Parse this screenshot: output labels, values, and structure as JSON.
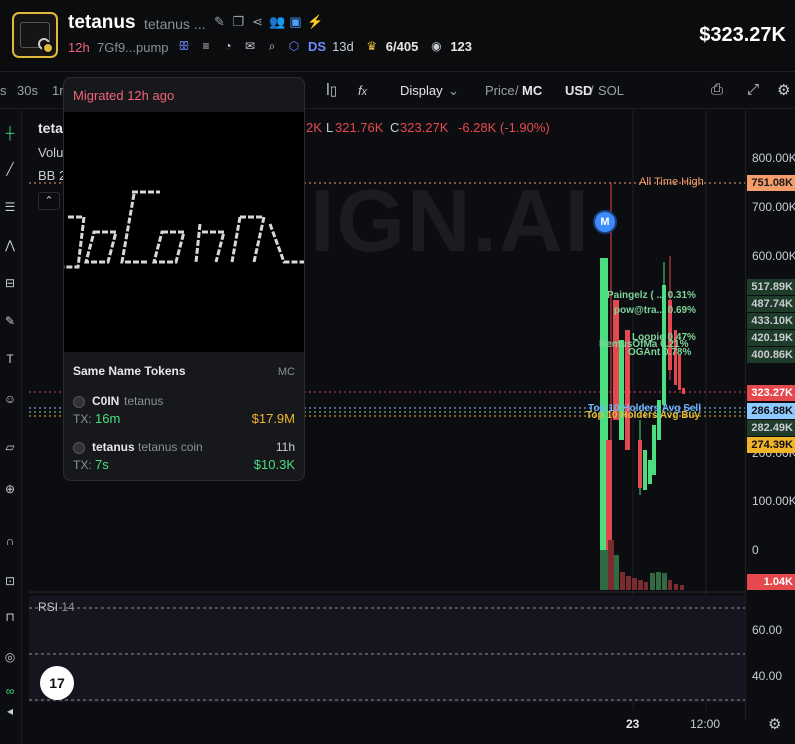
{
  "header": {
    "token_name": "tetanus",
    "token_subname": "tetanus ...",
    "age": "12h",
    "address": "7Gf9...pump",
    "ds_label": "DS",
    "ds_value": "13d",
    "holders": "6/405",
    "viewers": "123",
    "price": "$323.27K",
    "icons": [
      "edit-icon",
      "copy-icon",
      "share-icon",
      "users-icon",
      "twitter-icon",
      "bolt-icon"
    ]
  },
  "toolbar": {
    "tf_s": "s",
    "tf_30s": "30s",
    "tf_1m": "1r",
    "display": "Display",
    "price_label": "Price",
    "mc_label": "MC",
    "usd_label": "USD",
    "sol_label": "SOL"
  },
  "chart": {
    "symbol": "teta",
    "volume_label": "Volu",
    "bb_label": "BB 2",
    "ohlc": {
      "h_value": "2K",
      "l_label": "L",
      "l_value": "321.76K",
      "c_label": "C",
      "c_value": "323.27K",
      "change": "-6.28K (-1.90%)"
    },
    "watermark": "IGN.AI",
    "migration_marker": "M",
    "all_time_high_label": "All Time High",
    "annotations": [
      {
        "label": "Paingelz  ( ... 0.31%",
        "color": "#7fd39a"
      },
      {
        "label": "pow@tra... 0.69%",
        "color": "#7fd39a"
      },
      {
        "label": "Loopie  0.47%",
        "color": "#7fd39a"
      },
      {
        "label": "RemusOfMa  0.21%",
        "color": "#7fd39a"
      },
      {
        "label": "OGAnt  0.78%",
        "color": "#7fd39a"
      },
      {
        "label": "Top 10 Holders Avg Sell",
        "color": "#6fb6ff"
      },
      {
        "label": "Top 10 Holders Avg Buy",
        "color": "#e2b93b"
      }
    ],
    "rsi_label": "RSI",
    "rsi_value": "14",
    "tv_logo": "17"
  },
  "yaxis": {
    "ticks": [
      "800.00K",
      "700.00K",
      "600.00K",
      "200.00K",
      "100.00K",
      "0",
      "60.00",
      "40.00"
    ],
    "badges": [
      {
        "value": "751.08K",
        "bg": "#f59e6b",
        "fg": "#1a1a1a"
      },
      {
        "value": "517.89K",
        "bg": "#1f3b2a",
        "fg": "#c9ccd2"
      },
      {
        "value": "487.74K",
        "bg": "#1f3b2a",
        "fg": "#c9ccd2"
      },
      {
        "value": "433.10K",
        "bg": "#1f3b2a",
        "fg": "#c9ccd2"
      },
      {
        "value": "420.19K",
        "bg": "#1f3b2a",
        "fg": "#c9ccd2"
      },
      {
        "value": "400.86K",
        "bg": "#1f3b2a",
        "fg": "#c9ccd2"
      },
      {
        "value": "323.27K",
        "bg": "#e5484d",
        "fg": "#ffffff"
      },
      {
        "value": "286.88K",
        "bg": "#8ec9ff",
        "fg": "#0c0d10"
      },
      {
        "value": "282.49K",
        "bg": "#1f3b2a",
        "fg": "#c9ccd2"
      },
      {
        "value": "274.39K",
        "bg": "#f0b429",
        "fg": "#0c0d10"
      },
      {
        "value": "1.04K",
        "bg": "#e5484d",
        "fg": "#ffffff"
      }
    ]
  },
  "timeaxis": {
    "labels": [
      "23",
      "12:00"
    ]
  },
  "popover": {
    "title": "Migrated 12h ago",
    "section_title": "Same Name Tokens",
    "section_col": "MC",
    "tokens": [
      {
        "name": "C0IN",
        "sub": "tetanus",
        "tx_label": "TX:",
        "tx_value": "16m",
        "mc": "$17.9M",
        "mc_color": "#f0b429",
        "age": ""
      },
      {
        "name": "tetanus",
        "sub": "tetanus coin",
        "tx_label": "TX:",
        "tx_value": "7s",
        "mc": "$10.3K",
        "mc_color": "#4ade80",
        "age": "11h"
      }
    ]
  },
  "colors": {
    "up": "#4ade80",
    "down": "#e5484d",
    "accent_gold": "#e2b93b",
    "brand_pink": "#f0647a"
  }
}
